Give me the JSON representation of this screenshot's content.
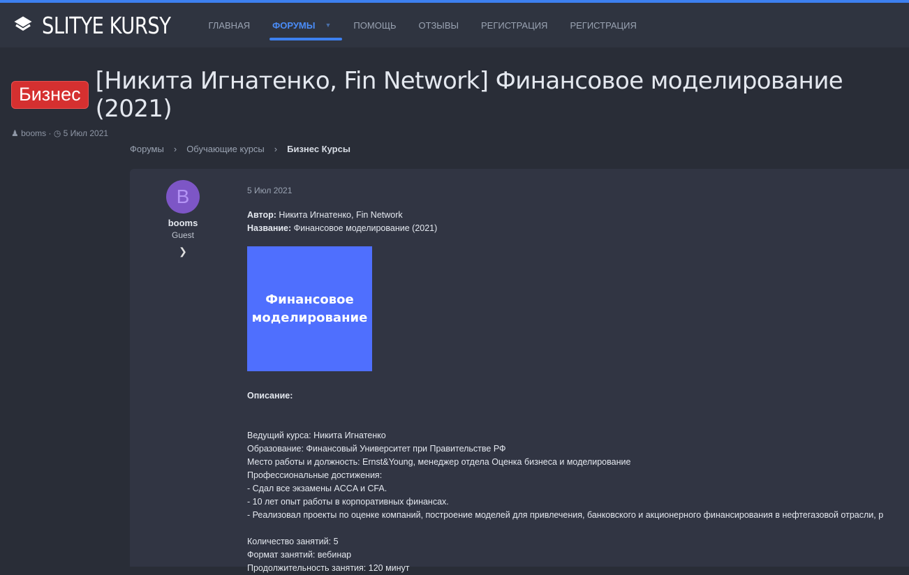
{
  "site": {
    "name": "SLITYE KURSY"
  },
  "nav": [
    {
      "label": "ГЛАВНАЯ"
    },
    {
      "label": "ФОРУМЫ"
    },
    {
      "label": "ПОМОЩЬ"
    },
    {
      "label": "ОТЗЫВЫ"
    },
    {
      "label": "РЕГИСТРАЦИЯ"
    },
    {
      "label": "РЕГИСТРАЦИЯ"
    }
  ],
  "thread": {
    "prefix": "Бизнес",
    "title": "[Никита Игнатенко, Fin Network] Финансовое моделирование (2021)",
    "author": "booms",
    "date": "5 Июл 2021"
  },
  "breadcrumb": [
    "Форумы",
    "Обучающие курсы",
    "Бизнес Курсы"
  ],
  "post": {
    "avatar_letter": "B",
    "username": "booms",
    "role": "Guest",
    "date": "5 Июл 2021",
    "author_label": "Автор:",
    "author_value": " Никита Игнатенко, Fin Network",
    "name_label": "Название:",
    "name_value": " Финансовое моделирование (2021)",
    "cover_line1": "Финансовое",
    "cover_line2": "моделирование",
    "description_label": "Описание:",
    "lines": [
      "Ведущий курса: Никита Игнатенко",
      "Образование: Финансовый Университет при Правительстве РФ",
      "Место работы и должность: Ernst&Young, менеджер отдела Оценка бизнеса и моделирование",
      "Профессиональные достижения:",
      "- Сдал все экзамены ACCA и CFA.",
      "- 10 лет опыт работы в корпоративных финансах.",
      "- Реализовал проекты по оценке компаний, построение моделей для привлечения, банковского и акционерного финансирования в нефтегазовой отрасли, р"
    ],
    "lines2": [
      "Количество занятий: 5",
      "Формат занятий: вебинар",
      "Продолжительность занятия: 120 минут"
    ]
  }
}
